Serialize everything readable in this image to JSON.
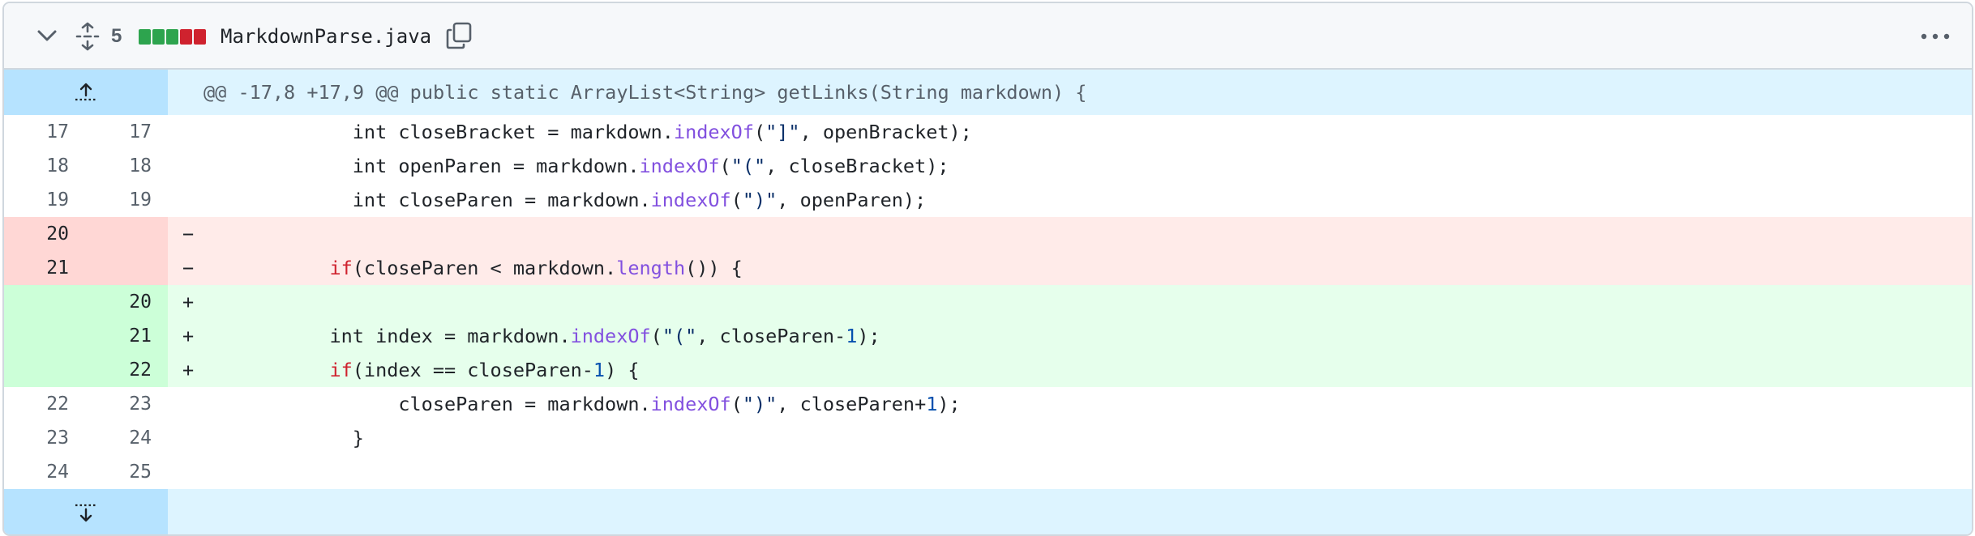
{
  "file": {
    "changes_count": "5",
    "file_name": "MarkdownParse.java",
    "diffstat": [
      "added",
      "added",
      "added",
      "deleted",
      "deleted"
    ]
  },
  "colors": {
    "added": "#2da44e",
    "deleted": "#cf222e",
    "hunk_bg": "#ddf4ff",
    "hunk_gutter": "#b6e3ff",
    "del_bg": "#ffebe9",
    "add_bg": "#e6ffec"
  },
  "hunk_header": "@@ -17,8 +17,9 @@ public static ArrayList<String> getLinks(String markdown) {",
  "lines": [
    {
      "type": "ctx",
      "old": "17",
      "new": "17",
      "marker": "",
      "indent": "            ",
      "tokens": [
        [
          "p",
          "int closeBracket = markdown."
        ],
        [
          "fn",
          "indexOf"
        ],
        [
          "p",
          "("
        ],
        [
          "str",
          "\"]\""
        ],
        [
          "p",
          ", openBracket);"
        ]
      ]
    },
    {
      "type": "ctx",
      "old": "18",
      "new": "18",
      "marker": "",
      "indent": "            ",
      "tokens": [
        [
          "p",
          "int openParen = markdown."
        ],
        [
          "fn",
          "indexOf"
        ],
        [
          "p",
          "("
        ],
        [
          "str",
          "\"(\""
        ],
        [
          "p",
          ", closeBracket);"
        ]
      ]
    },
    {
      "type": "ctx",
      "old": "19",
      "new": "19",
      "marker": "",
      "indent": "            ",
      "tokens": [
        [
          "p",
          "int closeParen = markdown."
        ],
        [
          "fn",
          "indexOf"
        ],
        [
          "p",
          "("
        ],
        [
          "str",
          "\")\""
        ],
        [
          "p",
          ", openParen);"
        ]
      ]
    },
    {
      "type": "del",
      "old": "20",
      "new": "",
      "marker": "−",
      "indent": "",
      "tokens": []
    },
    {
      "type": "del",
      "old": "21",
      "new": "",
      "marker": "−",
      "indent": "          ",
      "tokens": [
        [
          "kw",
          "if"
        ],
        [
          "p",
          "(closeParen < markdown."
        ],
        [
          "fn",
          "length"
        ],
        [
          "p",
          "()) {"
        ]
      ]
    },
    {
      "type": "add",
      "old": "",
      "new": "20",
      "marker": "+",
      "indent": "",
      "tokens": []
    },
    {
      "type": "add",
      "old": "",
      "new": "21",
      "marker": "+",
      "indent": "          ",
      "tokens": [
        [
          "p",
          "int index = markdown."
        ],
        [
          "fn",
          "indexOf"
        ],
        [
          "p",
          "("
        ],
        [
          "str",
          "\"(\""
        ],
        [
          "p",
          ", closeParen-"
        ],
        [
          "num",
          "1"
        ],
        [
          "p",
          ");"
        ]
      ]
    },
    {
      "type": "add",
      "old": "",
      "new": "22",
      "marker": "+",
      "indent": "          ",
      "tokens": [
        [
          "kw",
          "if"
        ],
        [
          "p",
          "(index == closeParen-"
        ],
        [
          "num",
          "1"
        ],
        [
          "p",
          ") {"
        ]
      ]
    },
    {
      "type": "ctx",
      "old": "22",
      "new": "23",
      "marker": "",
      "indent": "                ",
      "tokens": [
        [
          "p",
          "closeParen = markdown."
        ],
        [
          "fn",
          "indexOf"
        ],
        [
          "p",
          "("
        ],
        [
          "str",
          "\")\""
        ],
        [
          "p",
          ", closeParen+"
        ],
        [
          "num",
          "1"
        ],
        [
          "p",
          ");"
        ]
      ]
    },
    {
      "type": "ctx",
      "old": "23",
      "new": "24",
      "marker": "",
      "indent": "            ",
      "tokens": [
        [
          "p",
          "}"
        ]
      ]
    },
    {
      "type": "ctx",
      "old": "24",
      "new": "25",
      "marker": "",
      "indent": "",
      "tokens": []
    }
  ]
}
